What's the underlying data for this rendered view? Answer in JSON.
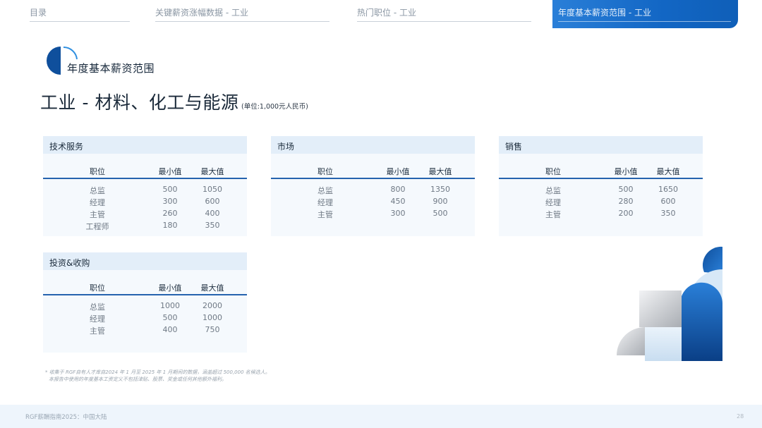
{
  "nav": {
    "items": [
      "目录",
      "关键薪资涨幅数据 - 工业",
      "热门职位 - 工业"
    ],
    "active": "年度基本薪资范围 - 工业"
  },
  "section": {
    "label": "年度基本薪资范围",
    "title": "工业 - 材料、化工与能源",
    "unit": "(单位:1,000元人民币)"
  },
  "columns": {
    "role": "职位",
    "min": "最小值",
    "max": "最大值"
  },
  "tables": [
    {
      "name": "技术服务",
      "rows": [
        {
          "role": "总监",
          "min": "500",
          "max": "1050"
        },
        {
          "role": "经理",
          "min": "300",
          "max": "600"
        },
        {
          "role": "主管",
          "min": "260",
          "max": "400"
        },
        {
          "role": "工程师",
          "min": "180",
          "max": "350"
        }
      ]
    },
    {
      "name": "市场",
      "rows": [
        {
          "role": "总监",
          "min": "800",
          "max": "1350"
        },
        {
          "role": "经理",
          "min": "450",
          "max": "900"
        },
        {
          "role": "主管",
          "min": "300",
          "max": "500"
        }
      ]
    },
    {
      "name": "销售",
      "rows": [
        {
          "role": "总监",
          "min": "500",
          "max": "1650"
        },
        {
          "role": "经理",
          "min": "280",
          "max": "600"
        },
        {
          "role": "主管",
          "min": "200",
          "max": "350"
        }
      ]
    },
    {
      "name": "投资&收购",
      "rows": [
        {
          "role": "总监",
          "min": "1000",
          "max": "2000"
        },
        {
          "role": "经理",
          "min": "500",
          "max": "1000"
        },
        {
          "role": "主管",
          "min": "400",
          "max": "750"
        }
      ]
    }
  ],
  "footnotes": [
    "* 收集于 RGF自有人才库自2024 年 1 月至 2025 年 1 月期间的数据，涵盖超过 500,000 名候选人。",
    "本报告中使用的年度基本工资定义不包括津贴、股票、奖金或任何其他额外福利。"
  ],
  "footer": {
    "left": "RGF薪酬指南2025：中国大陆",
    "page": "28"
  },
  "colors": {
    "accent": "#1266c4",
    "panel_bg": "#f5f9fd",
    "panel_header": "#e3eef9",
    "rule": "#2563ae"
  }
}
